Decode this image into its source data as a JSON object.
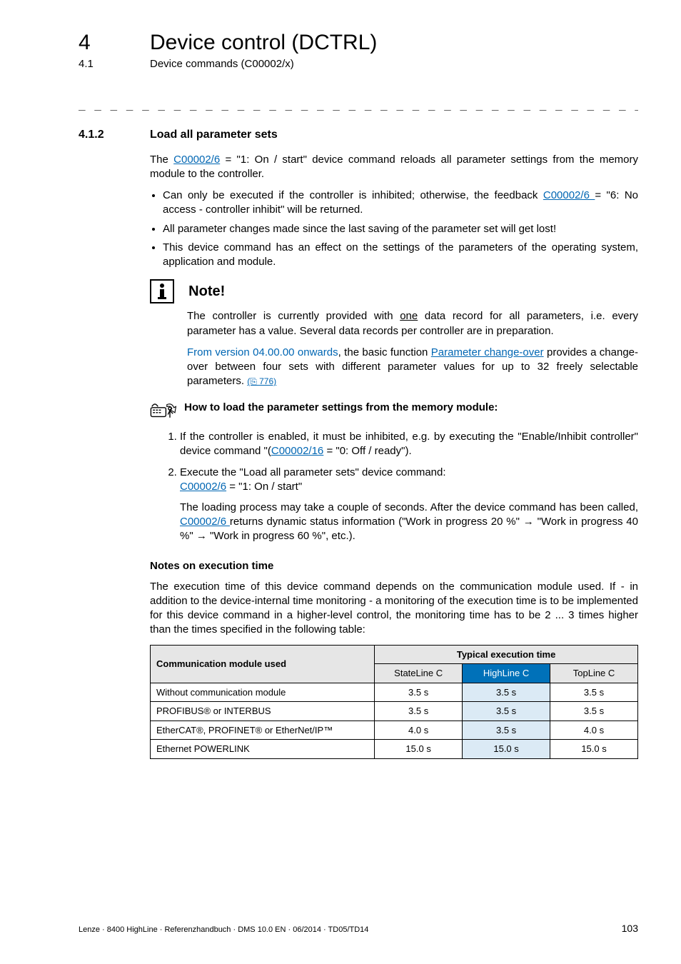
{
  "header": {
    "chapter_num": "4",
    "chapter_title": "Device control (DCTRL)",
    "sub_num": "4.1",
    "sub_title": "Device commands (C00002/x)"
  },
  "dashline": "_ _ _ _ _ _ _ _ _ _ _ _ _ _ _ _ _ _ _ _ _ _ _ _ _ _ _ _ _ _ _ _ _ _ _ _ _ _ _ _ _ _ _ _ _ _ _ _ _ _ _ _ _ _ _ _ _ _ _ _ _ _ _ _",
  "section": {
    "num": "4.1.2",
    "title": "Load all parameter sets"
  },
  "intro": {
    "p1_a": "The ",
    "p1_link": "C00002/6",
    "p1_b": " = \"1: On / start\" device command reloads all parameter settings from the memory module to the controller."
  },
  "bullets": {
    "b1_a": "Can only be executed if the controller is inhibited; otherwise, the feedback ",
    "b1_link": "C00002/6 ",
    "b1_b": " = \"6: No access - controller inhibit\" will be returned.",
    "b2": "All parameter changes made since the last saving of the parameter set will get lost!",
    "b3": "This device command has an effect on the settings of the parameters of the operating system, application and module."
  },
  "note": {
    "title": "Note!",
    "p1_a": "The controller is currently provided with ",
    "p1_u": "one",
    "p1_b": " data record for all parameters, i.e. every parameter has a value. Several data records per controller are in preparation.",
    "p2_a": "From version 04.00.00 onwards",
    "p2_b": ", the basic function ",
    "p2_link": "Parameter change-over",
    "p2_c": " provides a change-over between four sets with different parameter values for up to 32 freely selectable parameters. ",
    "p2_ref": "(⎘ 776)"
  },
  "howto": {
    "title": "How to load the parameter settings from the memory module:",
    "s1_a": "If the controller is enabled, it must be inhibited, e.g. by executing the \"Enable/Inhibit controller\" device command \"(",
    "s1_link": "C00002/16",
    "s1_b": " = \"0: Off / ready\").",
    "s2_a": "Execute the \"Load all parameter sets\" device command:",
    "s2_link": "C00002/6",
    "s2_b": " = \"1: On / start\"",
    "s2_sub_a": "The loading process may take a couple of seconds. After the device command has been called, ",
    "s2_sub_link": "C00002/6 ",
    "s2_sub_b": " returns dynamic status information (\"Work in progress 20 %\" → \"Work in progress 40 %\" → \"Work in progress 60 %\", etc.)."
  },
  "exec": {
    "heading": "Notes on execution time",
    "para": "The execution time of this device command depends on the communication module used. If - in addition to the device-internal time monitoring - a monitoring of the execution time is to be implemented for this device command in a higher-level control, the monitoring time has to be 2 ... 3 times higher than the times specified in the following table:",
    "th_module": "Communication module used",
    "th_time": "Typical execution time",
    "cols": {
      "c1": "StateLine C",
      "c2": "HighLine C",
      "c3": "TopLine C"
    },
    "rows": [
      {
        "label": "Without communication module",
        "v1": "3.5 s",
        "v2": "3.5 s",
        "v3": "3.5 s"
      },
      {
        "label": "PROFIBUS® or INTERBUS",
        "v1": "3.5 s",
        "v2": "3.5 s",
        "v3": "3.5 s"
      },
      {
        "label": "EtherCAT®, PROFINET® or EtherNet/IP™",
        "v1": "4.0 s",
        "v2": "3.5 s",
        "v3": "4.0 s"
      },
      {
        "label": "Ethernet POWERLINK",
        "v1": "15.0 s",
        "v2": "15.0 s",
        "v3": "15.0 s"
      }
    ]
  },
  "footer": {
    "left": "Lenze · 8400 HighLine · Referenzhandbuch · DMS 10.0 EN · 06/2014 · TD05/TD14",
    "page": "103"
  }
}
